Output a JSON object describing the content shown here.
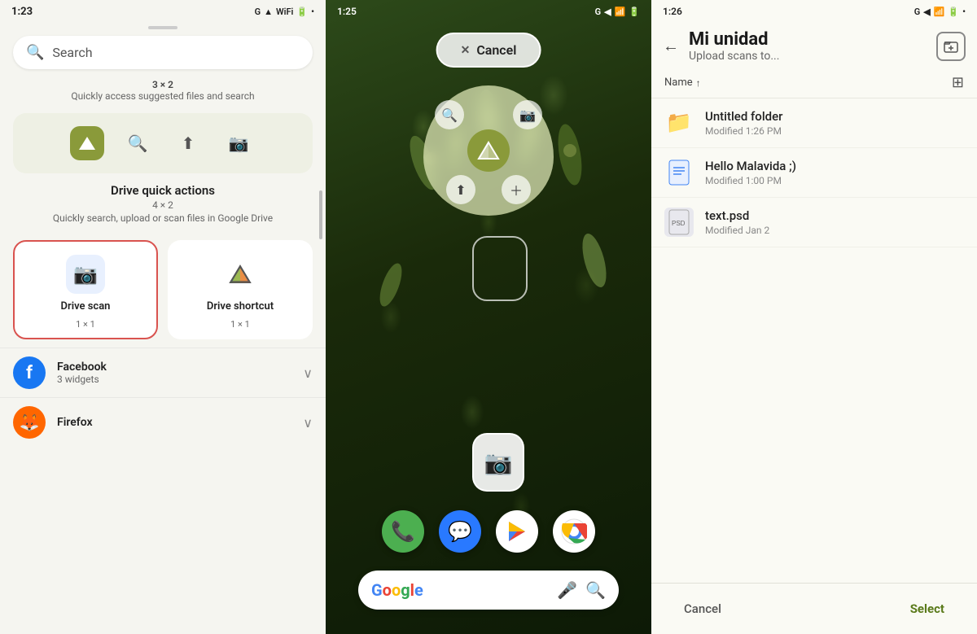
{
  "panel1": {
    "status_bar": {
      "time": "1:23",
      "icons": [
        "G",
        "navigation",
        "signal",
        "wifi",
        "battery",
        "dot"
      ]
    },
    "search": {
      "placeholder": "Search"
    },
    "grid_info": {
      "size": "3 × 2",
      "desc": "Quickly access suggested files and search"
    },
    "widget_preview": {
      "icons": [
        "drive",
        "search",
        "upload",
        "camera"
      ]
    },
    "quick_actions": {
      "title": "Drive quick actions",
      "size": "4 × 2",
      "desc": "Quickly search, upload or scan files in Google Drive"
    },
    "widget_options": [
      {
        "label": "Drive scan",
        "size": "1 × 1",
        "selected": true,
        "icon": "camera"
      },
      {
        "label": "Drive shortcut",
        "size": "1 × 1",
        "selected": false,
        "icon": "drive-triangle"
      }
    ],
    "apps": [
      {
        "name": "Facebook",
        "sub": "3 widgets",
        "icon": "fb",
        "color": "#1877f2"
      },
      {
        "name": "Firefox",
        "sub": "",
        "icon": "ff",
        "color": "#ff6600"
      }
    ]
  },
  "panel2": {
    "status_bar": {
      "time": "1:25",
      "icons": [
        "G",
        "navigation",
        "signal",
        "wifi",
        "battery"
      ]
    },
    "cancel_button": "Cancel",
    "radial_menu": {
      "icons": [
        "search",
        "camera",
        "drive",
        "upload",
        "plus"
      ]
    },
    "dock_apps": [
      "phone",
      "messages",
      "play",
      "chrome"
    ],
    "search": {
      "mic": "mic",
      "lens": "lens"
    }
  },
  "panel3": {
    "status_bar": {
      "time": "1:26",
      "icons": [
        "G",
        "navigation",
        "signal",
        "wifi",
        "battery"
      ]
    },
    "header": {
      "title": "Mi unidad",
      "subtitle": "Upload scans to...",
      "back_label": "back",
      "new_folder_label": "new folder"
    },
    "sort": {
      "label": "Name",
      "direction": "↑"
    },
    "files": [
      {
        "name": "Untitled folder",
        "date": "Modified 1:26 PM",
        "type": "folder"
      },
      {
        "name": "Hello Malavida ;)",
        "date": "Modified 1:00 PM",
        "type": "doc"
      },
      {
        "name": "text.psd",
        "date": "Modified Jan 2",
        "type": "psd"
      }
    ],
    "footer": {
      "cancel": "Cancel",
      "select": "Select"
    }
  }
}
